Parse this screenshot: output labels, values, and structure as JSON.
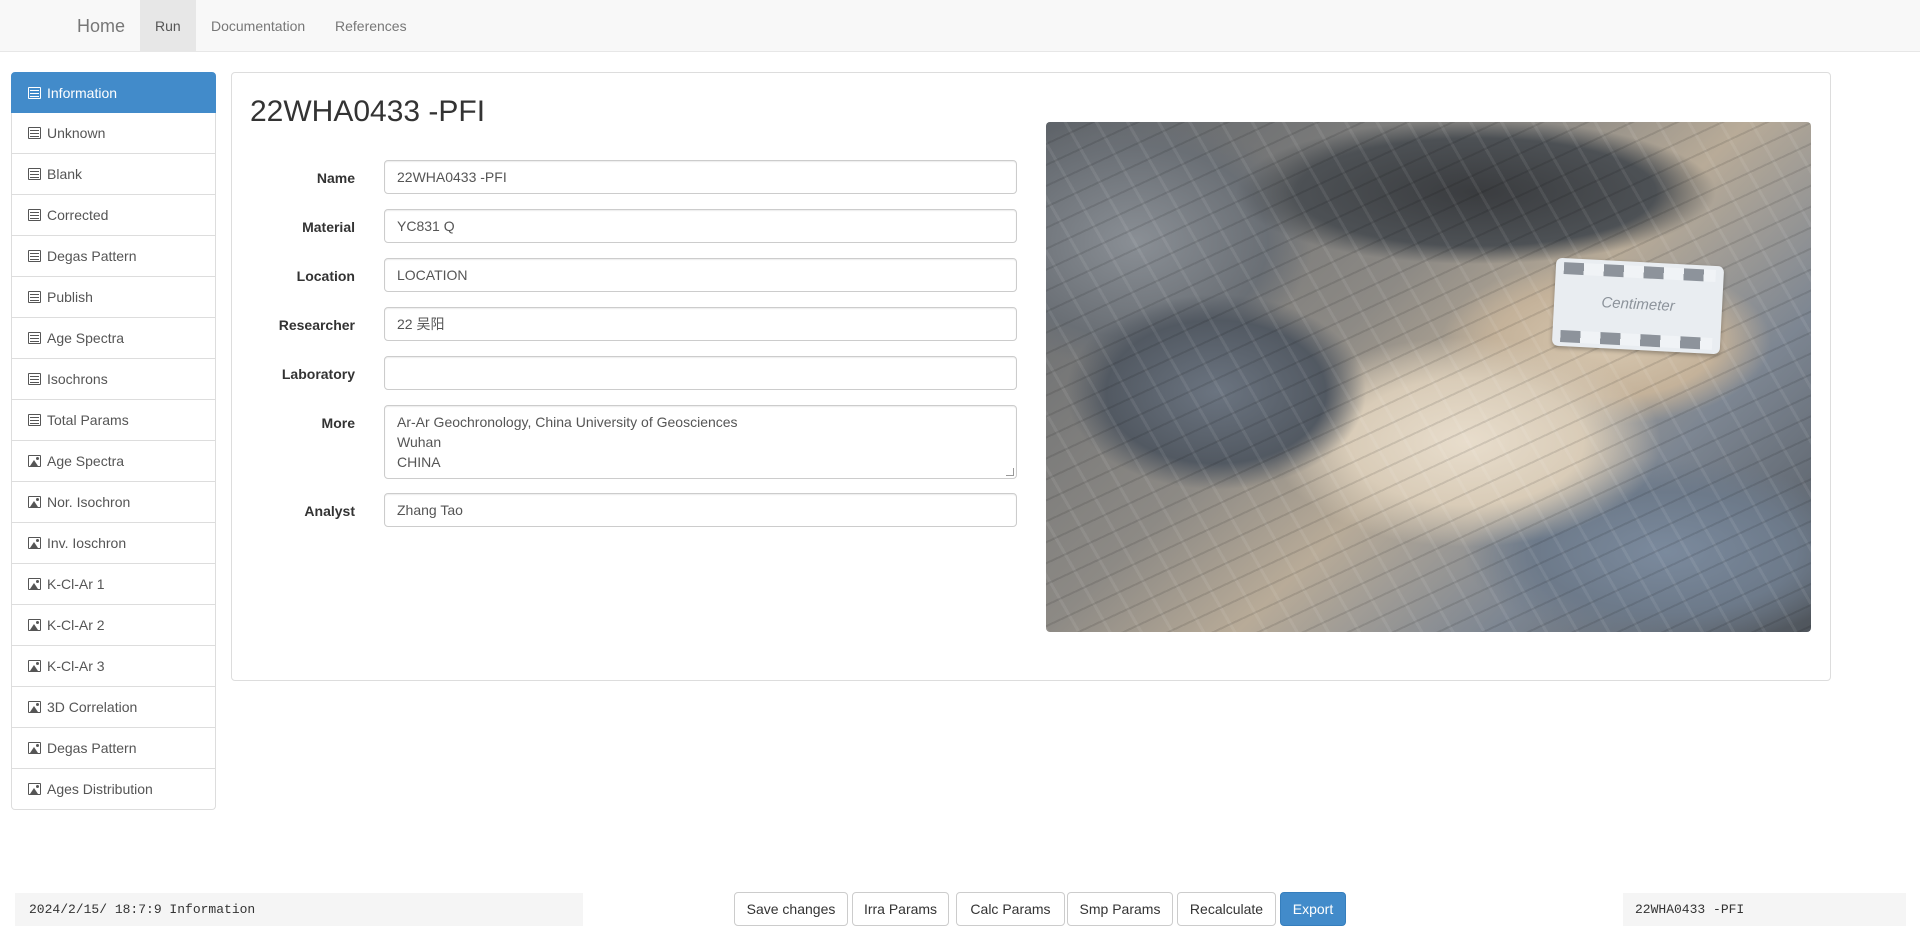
{
  "navbar": {
    "brand": "Home",
    "tabs": [
      {
        "label": "Run",
        "active": true
      },
      {
        "label": "Documentation",
        "active": false
      },
      {
        "label": "References",
        "active": false
      }
    ]
  },
  "sidebar": {
    "items": [
      {
        "label": "Information",
        "icon": "table-icon",
        "active": true
      },
      {
        "label": "Unknown",
        "icon": "table-icon"
      },
      {
        "label": "Blank",
        "icon": "table-icon"
      },
      {
        "label": "Corrected",
        "icon": "table-icon"
      },
      {
        "label": "Degas Pattern",
        "icon": "table-icon"
      },
      {
        "label": "Publish",
        "icon": "table-icon"
      },
      {
        "label": "Age Spectra",
        "icon": "table-icon"
      },
      {
        "label": "Isochrons",
        "icon": "table-icon"
      },
      {
        "label": "Total Params",
        "icon": "table-icon"
      },
      {
        "label": "Age Spectra",
        "icon": "picture-icon"
      },
      {
        "label": "Nor. Isochron",
        "icon": "picture-icon"
      },
      {
        "label": "Inv. Ioschron",
        "icon": "picture-icon"
      },
      {
        "label": "K-Cl-Ar 1",
        "icon": "picture-icon"
      },
      {
        "label": "K-Cl-Ar 2",
        "icon": "picture-icon"
      },
      {
        "label": "K-Cl-Ar 3",
        "icon": "picture-icon"
      },
      {
        "label": "3D Correlation",
        "icon": "picture-icon"
      },
      {
        "label": "Degas Pattern",
        "icon": "picture-icon"
      },
      {
        "label": "Ages Distribution",
        "icon": "picture-icon"
      }
    ]
  },
  "main": {
    "title": "22WHA0433 -PFI",
    "fields": {
      "name": {
        "label": "Name",
        "value": "22WHA0433 -PFI"
      },
      "material": {
        "label": "Material",
        "value": "YC831 Q"
      },
      "location": {
        "label": "Location",
        "value": "LOCATION"
      },
      "researcher": {
        "label": "Researcher",
        "value": "22 吴阳"
      },
      "laboratory": {
        "label": "Laboratory",
        "value": ""
      },
      "more": {
        "label": "More",
        "value": "Ar-Ar Geochronology, China University of Geosciences\nWuhan\nCHINA"
      },
      "analyst": {
        "label": "Analyst",
        "value": "Zhang Tao"
      }
    },
    "photo": {
      "scale_card_text": "Centimeter"
    }
  },
  "footer": {
    "status_left": "2024/2/15/ 18:7:9 Information",
    "status_right": "22WHA0433 -PFI",
    "buttons": {
      "save": "Save changes",
      "irra": "Irra Params",
      "calc": "Calc Params",
      "smp": "Smp Params",
      "recalc": "Recalculate",
      "export": "Export"
    }
  },
  "colors": {
    "primary": "#428bca",
    "navbar_bg": "#f8f8f8"
  }
}
